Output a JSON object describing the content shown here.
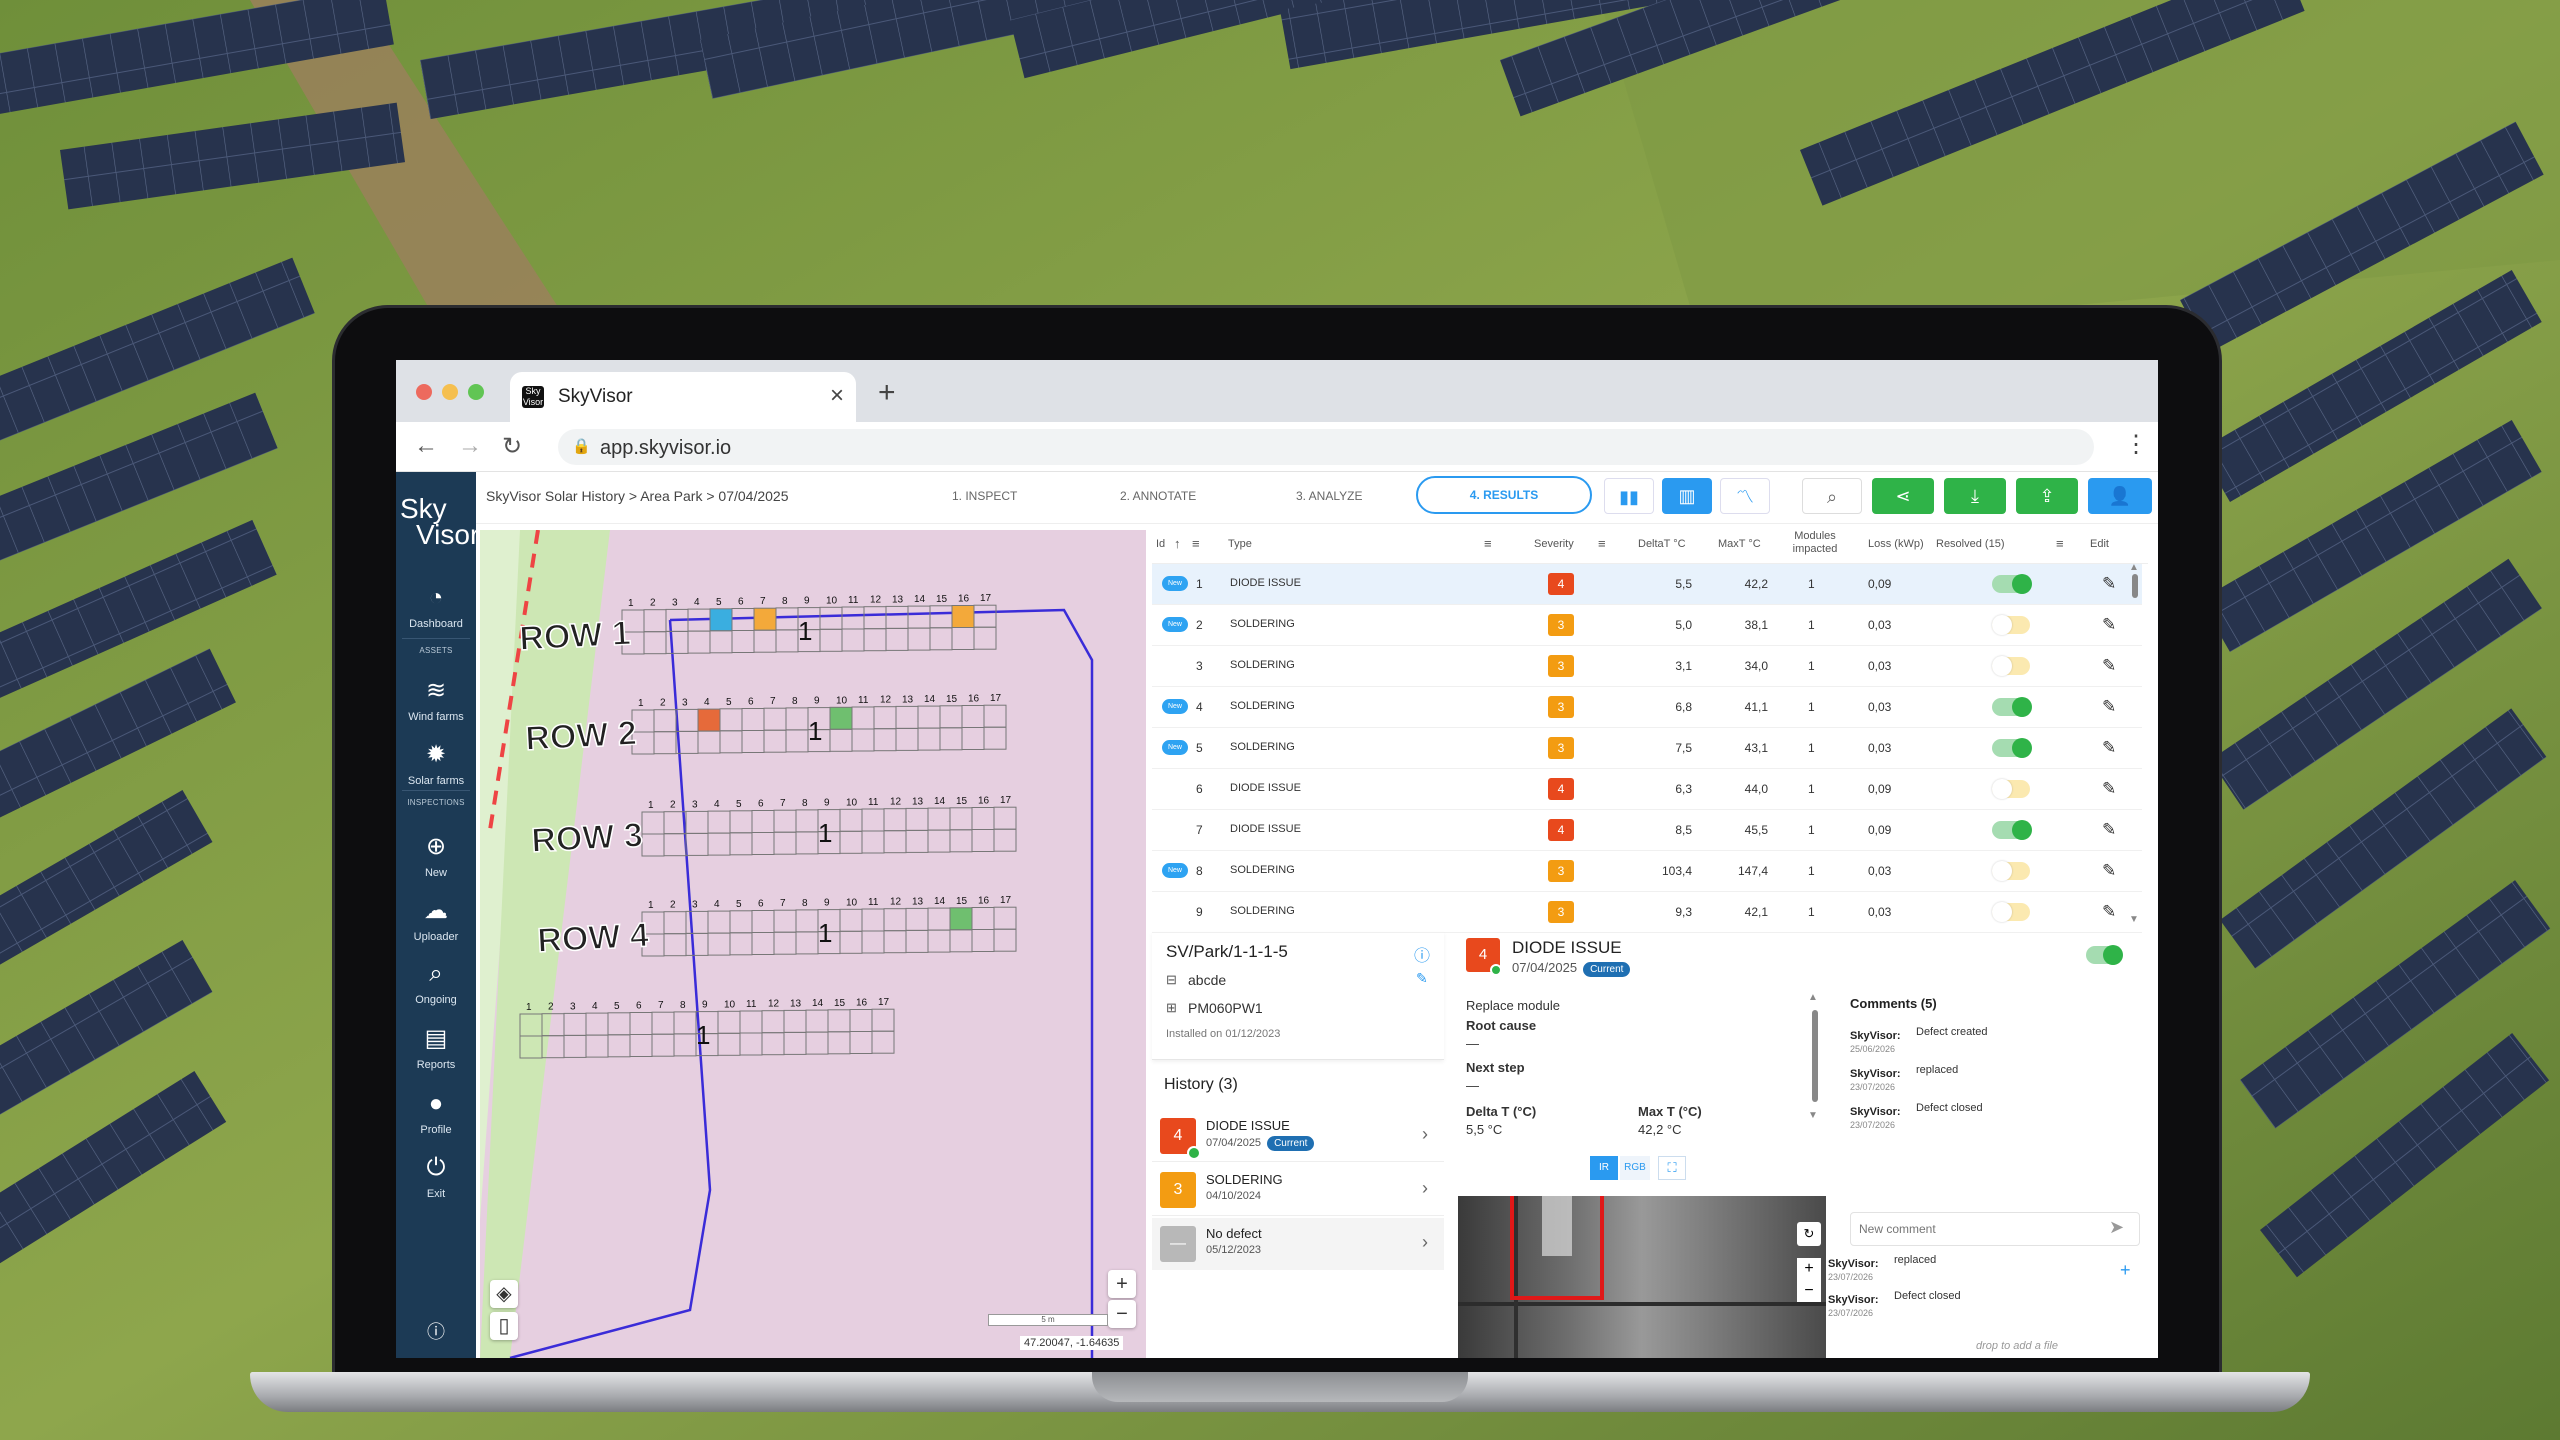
{
  "browser": {
    "tab_title": "SkyVisor",
    "favicon_text": "Sky Visor",
    "url": "app.skyvisor.io",
    "traffic_lights": [
      "#ed6a5e",
      "#f5bf4f",
      "#61c554"
    ]
  },
  "sidebar": {
    "logo_line1": "Sky",
    "logo_line2": "Visor",
    "items": [
      {
        "label": "Dashboard",
        "icon": "gauge-icon"
      },
      {
        "label": "Wind farms",
        "icon": "wind-icon"
      },
      {
        "label": "Solar farms",
        "icon": "sun-icon"
      },
      {
        "label": "New",
        "icon": "plus-circle-icon"
      },
      {
        "label": "Uploader",
        "icon": "cloud-upload-icon"
      },
      {
        "label": "Ongoing",
        "icon": "magnifier-icon"
      },
      {
        "label": "Reports",
        "icon": "document-icon"
      },
      {
        "label": "Profile",
        "icon": "user-icon"
      },
      {
        "label": "Exit",
        "icon": "power-icon"
      }
    ],
    "section_assets": "ASSETS",
    "section_inspections": "INSPECTIONS",
    "help_icon": "help-icon"
  },
  "topbar": {
    "breadcrumb": [
      "SkyVisor Solar History",
      "Area Park",
      "07/04/2025"
    ],
    "steps": [
      "1. INSPECT",
      "2. ANNOTATE",
      "3. ANALYZE",
      "4. RESULTS"
    ],
    "active_step": "4. RESULTS",
    "accent": "#2a9af0",
    "action_color": "#2fb348"
  },
  "map": {
    "rows": [
      "ROW 1",
      "ROW 2",
      "ROW 3",
      "ROW 4"
    ],
    "cell_numbers": [
      "1",
      "2",
      "3",
      "4",
      "5",
      "6",
      "7",
      "8",
      "9",
      "10",
      "11",
      "12",
      "13",
      "14",
      "15",
      "16",
      "17"
    ],
    "row_string_label": "1",
    "coords": "47.20047, -1.64635",
    "scale_label": "5 m"
  },
  "table": {
    "headers": {
      "id": "Id",
      "type": "Type",
      "severity": "Severity",
      "delta": "DeltaT °C",
      "max": "MaxT °C",
      "modules": "Modules impacted",
      "loss": "Loss (kWp)",
      "resolved": "Resolved (15)",
      "edit": "Edit"
    },
    "new_label": "New",
    "rows": [
      {
        "id": "1",
        "isNew": true,
        "type": "DIODE ISSUE",
        "severity": "4",
        "delta": "5,5",
        "max": "42,2",
        "modules": "1",
        "loss": "0,09",
        "resolved": true
      },
      {
        "id": "2",
        "isNew": true,
        "type": "SOLDERING",
        "severity": "3",
        "delta": "5,0",
        "max": "38,1",
        "modules": "1",
        "loss": "0,03",
        "resolved": false
      },
      {
        "id": "3",
        "isNew": false,
        "type": "SOLDERING",
        "severity": "3",
        "delta": "3,1",
        "max": "34,0",
        "modules": "1",
        "loss": "0,03",
        "resolved": false
      },
      {
        "id": "4",
        "isNew": true,
        "type": "SOLDERING",
        "severity": "3",
        "delta": "6,8",
        "max": "41,1",
        "modules": "1",
        "loss": "0,03",
        "resolved": true
      },
      {
        "id": "5",
        "isNew": true,
        "type": "SOLDERING",
        "severity": "3",
        "delta": "7,5",
        "max": "43,1",
        "modules": "1",
        "loss": "0,03",
        "resolved": true
      },
      {
        "id": "6",
        "isNew": false,
        "type": "DIODE ISSUE",
        "severity": "4",
        "delta": "6,3",
        "max": "44,0",
        "modules": "1",
        "loss": "0,09",
        "resolved": false
      },
      {
        "id": "7",
        "isNew": false,
        "type": "DIODE ISSUE",
        "severity": "4",
        "delta": "8,5",
        "max": "45,5",
        "modules": "1",
        "loss": "0,09",
        "resolved": true
      },
      {
        "id": "8",
        "isNew": true,
        "type": "SOLDERING",
        "severity": "3",
        "delta": "103,4",
        "max": "147,4",
        "modules": "1",
        "loss": "0,03",
        "resolved": false
      },
      {
        "id": "9",
        "isNew": false,
        "type": "SOLDERING",
        "severity": "3",
        "delta": "9,3",
        "max": "42,1",
        "modules": "1",
        "loss": "0,03",
        "resolved": false
      }
    ],
    "severity_colors": {
      "3": "#f39c12",
      "4": "#e8491d"
    }
  },
  "asset": {
    "path": "SV/Park/1-1-1-5",
    "name": "abcde",
    "model": "PM060PW1",
    "installed": "Installed on 01/12/2023"
  },
  "history": {
    "title": "History (3)",
    "items": [
      {
        "badge": "4",
        "type": "DIODE ISSUE",
        "date": "07/04/2025",
        "current": "Current"
      },
      {
        "badge": "3",
        "type": "SOLDERING",
        "date": "04/10/2024"
      },
      {
        "badge": "—",
        "type": "No defect",
        "date": "05/12/2023"
      }
    ]
  },
  "detail": {
    "severity": "4",
    "type": "DIODE ISSUE",
    "date": "07/04/2025",
    "current": "Current",
    "action": "Replace module",
    "root_cause_label": "Root cause",
    "root_cause_value": "—",
    "next_step_label": "Next step",
    "next_step_value": "—",
    "delta_label": "Delta T (°C)",
    "delta_value": "5,5 °C",
    "max_label": "Max T (°C)",
    "max_value": "42,2 °C",
    "view_ir": "IR",
    "view_rgb": "RGB"
  },
  "comments": {
    "title": "Comments (5)",
    "items": [
      {
        "author": "SkyVisor:",
        "text": "Defect created",
        "date": "25/06/2026"
      },
      {
        "author": "SkyVisor:",
        "text": "replaced",
        "date": "23/07/2026"
      },
      {
        "author": "SkyVisor:",
        "text": "Defect closed",
        "date": "23/07/2026"
      }
    ],
    "placeholder": "New comment",
    "lower_items": [
      {
        "author": "SkyVisor:",
        "text": "replaced",
        "date": "23/07/2026"
      },
      {
        "author": "SkyVisor:",
        "text": "Defect closed",
        "date": "23/07/2026"
      }
    ],
    "drop_hint": "drop to add a file"
  }
}
